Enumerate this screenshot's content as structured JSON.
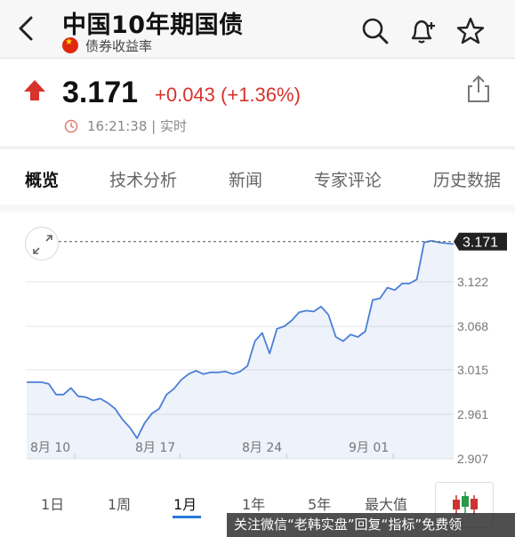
{
  "header": {
    "title": "中国10年期国债",
    "subtitle": "债券收益率",
    "icons": [
      "back-icon",
      "search-icon",
      "bell-add-icon",
      "star-icon"
    ]
  },
  "quote": {
    "price": "3.171",
    "change": "+0.043 (+1.36%)",
    "time": "16:21:38 | 实时",
    "colors": {
      "up": "#d8322c"
    }
  },
  "tabs": [
    {
      "label": "概览",
      "active": true
    },
    {
      "label": "技术分析"
    },
    {
      "label": "新闻"
    },
    {
      "label": "专家评论"
    },
    {
      "label": "历史数据"
    }
  ],
  "chart_data": {
    "type": "line",
    "x_tick_labels": [
      "8月 10",
      "8月 17",
      "8月 24",
      "9月 01"
    ],
    "y_tick_labels": [
      "3.122",
      "3.068",
      "3.015",
      "2.961",
      "2.907"
    ],
    "ylim": [
      2.907,
      3.175
    ],
    "current_value_label": "3.171",
    "line_color": "#4a7fd6",
    "values": [
      3.0,
      3.0,
      3.0,
      2.998,
      2.985,
      2.985,
      2.993,
      2.983,
      2.982,
      2.978,
      2.98,
      2.975,
      2.968,
      2.955,
      2.945,
      2.932,
      2.95,
      2.962,
      2.968,
      2.985,
      2.992,
      3.003,
      3.01,
      3.014,
      3.01,
      3.012,
      3.012,
      3.013,
      3.01,
      3.013,
      3.02,
      3.05,
      3.06,
      3.035,
      3.065,
      3.068,
      3.075,
      3.085,
      3.087,
      3.086,
      3.092,
      3.082,
      3.055,
      3.05,
      3.058,
      3.055,
      3.062,
      3.1,
      3.102,
      3.115,
      3.112,
      3.12,
      3.12,
      3.125,
      3.17,
      3.172,
      3.17,
      3.169,
      3.168
    ]
  },
  "ranges": {
    "items": [
      "1日",
      "1周",
      "1月",
      "1年",
      "5年",
      "最大值"
    ],
    "active_index": 2
  },
  "watermark": "关注微信“老韩实盘”回复“指标”免费领"
}
